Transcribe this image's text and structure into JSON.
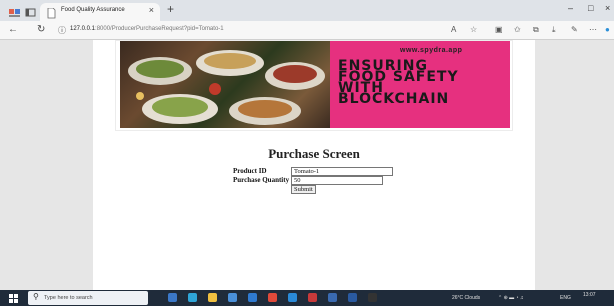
{
  "browser": {
    "tab_title": "Food Quality Assurance",
    "tab_close": "×",
    "new_tab": "+",
    "url_host": "127.0.0.1",
    "url_rest": ":8000/ProducerPurchaseRequest?pid=Tomato-1",
    "nav": {
      "back": "←",
      "reload": "↻",
      "info": "ⓘ"
    },
    "window_controls": {
      "minimize": "–",
      "maximize": "□",
      "close": "×"
    },
    "toolbar_icons": [
      "read-aloud-icon",
      "favorite-star-icon",
      "split-screen-icon",
      "favorites-icon",
      "collections-icon",
      "downloads-icon",
      "extensions-icon",
      "more-icon",
      "copilot-icon"
    ]
  },
  "banner": {
    "site": "www.spydra.app",
    "headline": [
      "ENSURING",
      "FOOD SAFETY",
      "WITH",
      "BLOCKCHAIN"
    ],
    "accent_color": "#e6307f"
  },
  "form": {
    "title": "Purchase Screen",
    "product_id_label": "Product ID",
    "product_id_value": "Tomato-1",
    "quantity_label": "Purchase Quantity",
    "quantity_value": "50",
    "submit_label": "Submit"
  },
  "taskbar": {
    "search_placeholder": "Type here to search",
    "weather": "26°C Clouds",
    "language": "ENG",
    "time": "13:07"
  }
}
